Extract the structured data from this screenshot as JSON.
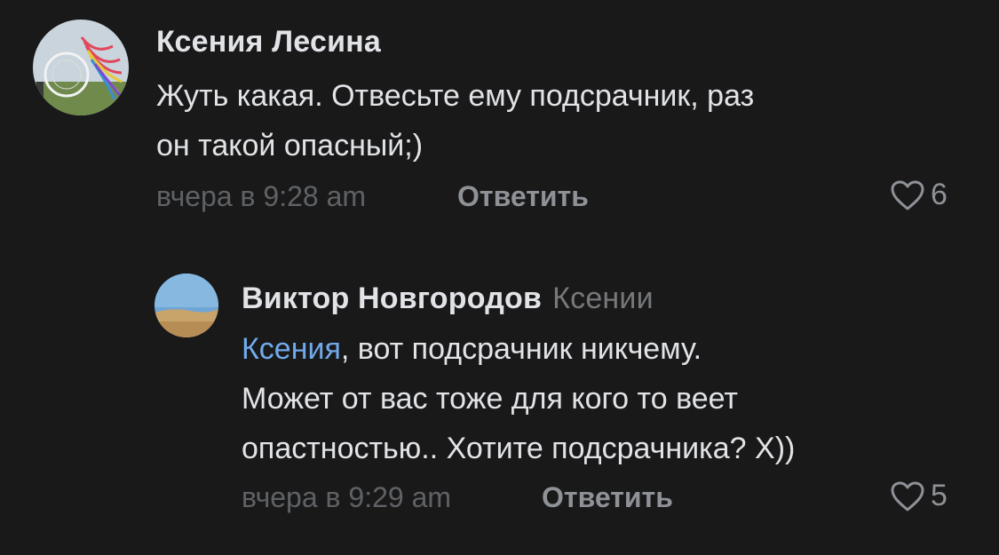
{
  "comments": [
    {
      "author": "Ксения Лесина",
      "avatar_icon": "dreamcatcher-photo-avatar",
      "text_lines": [
        "Жуть какая. Отвесьте ему подсрачник, раз",
        "он такой опасный;)"
      ],
      "timestamp": "вчера в 9:28 am",
      "reply_label": "Ответить",
      "likes": "6",
      "like_icon": "heart-outline-icon"
    },
    {
      "author": "Виктор Новгородов",
      "reply_to": "Ксении",
      "avatar_icon": "desert-landscape-photo-avatar",
      "mention": "Ксения",
      "text_line1_rest": ", вот подсрачник никчему.",
      "text_lines": [
        "Может от вас тоже для кого то веет",
        "опастностью.. Хотите подсрачника? Х))"
      ],
      "timestamp": "вчера в 9:29 am",
      "reply_label": "Ответить",
      "likes": "5",
      "like_icon": "heart-outline-icon"
    }
  ],
  "colors": {
    "background": "#19191a",
    "text": "#e1e3e6",
    "secondary": "#76787a",
    "link": "#71aaeb"
  }
}
